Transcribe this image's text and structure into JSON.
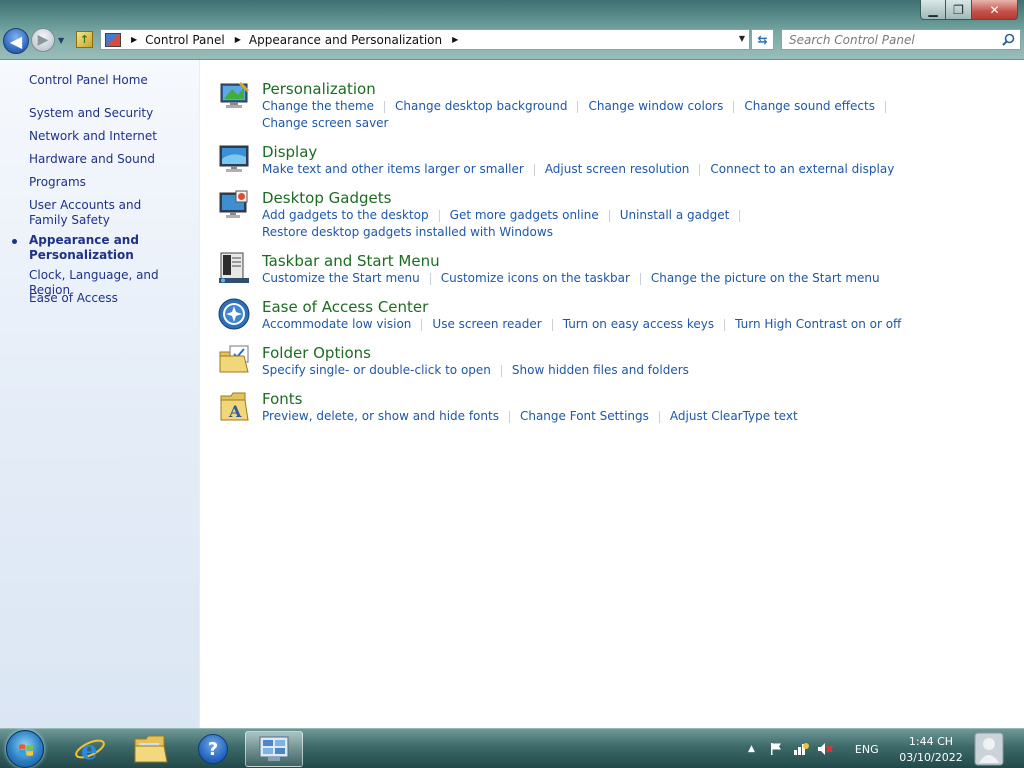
{
  "window": {
    "minimize": "▁",
    "maximize": "❐",
    "close": "✕"
  },
  "navigation": {
    "back": "◀",
    "forward": "▶",
    "breadcrumb": [
      "Control Panel",
      "Appearance and Personalization"
    ],
    "search_placeholder": "Search Control Panel"
  },
  "sidebar": {
    "home": "Control Panel Home",
    "items": [
      {
        "label": "System and Security"
      },
      {
        "label": "Network and Internet"
      },
      {
        "label": "Hardware and Sound"
      },
      {
        "label": "Programs"
      },
      {
        "label": "User Accounts and Family Safety"
      },
      {
        "label": "Appearance and Personalization",
        "current": true
      },
      {
        "label": "Clock, Language, and Region"
      },
      {
        "label": "Ease of Access"
      }
    ]
  },
  "categories": [
    {
      "title": "Personalization",
      "icon": "personalization-icon",
      "tasks": [
        "Change the theme",
        "Change desktop background",
        "Change window colors",
        "Change sound effects",
        "Change screen saver"
      ]
    },
    {
      "title": "Display",
      "icon": "display-icon",
      "tasks": [
        "Make text and other items larger or smaller",
        "Adjust screen resolution",
        "Connect to an external display"
      ]
    },
    {
      "title": "Desktop Gadgets",
      "icon": "gadgets-icon",
      "tasks": [
        "Add gadgets to the desktop",
        "Get more gadgets online",
        "Uninstall a gadget",
        "Restore desktop gadgets installed with Windows"
      ]
    },
    {
      "title": "Taskbar and Start Menu",
      "icon": "taskbar-icon",
      "tasks": [
        "Customize the Start menu",
        "Customize icons on the taskbar",
        "Change the picture on the Start menu"
      ]
    },
    {
      "title": "Ease of Access Center",
      "icon": "ease-of-access-icon",
      "tasks": [
        "Accommodate low vision",
        "Use screen reader",
        "Turn on easy access keys",
        "Turn High Contrast on or off"
      ]
    },
    {
      "title": "Folder Options",
      "icon": "folder-options-icon",
      "tasks": [
        "Specify single- or double-click to open",
        "Show hidden files and folders"
      ]
    },
    {
      "title": "Fonts",
      "icon": "fonts-icon",
      "tasks": [
        "Preview, delete, or show and hide fonts",
        "Change Font Settings",
        "Adjust ClearType text"
      ]
    }
  ],
  "taskbar": {
    "language": "ENG",
    "time": "1:44 CH",
    "date": "03/10/2022",
    "help_glyph": "?",
    "pinned": [
      "start-orb-icon",
      "internet-explorer-icon",
      "windows-explorer-icon",
      "help-icon",
      "control-panel-icon"
    ]
  },
  "colors": {
    "link": "#1e57a8",
    "category_title": "#1d6b22",
    "sidebar_link": "#1e3287"
  }
}
